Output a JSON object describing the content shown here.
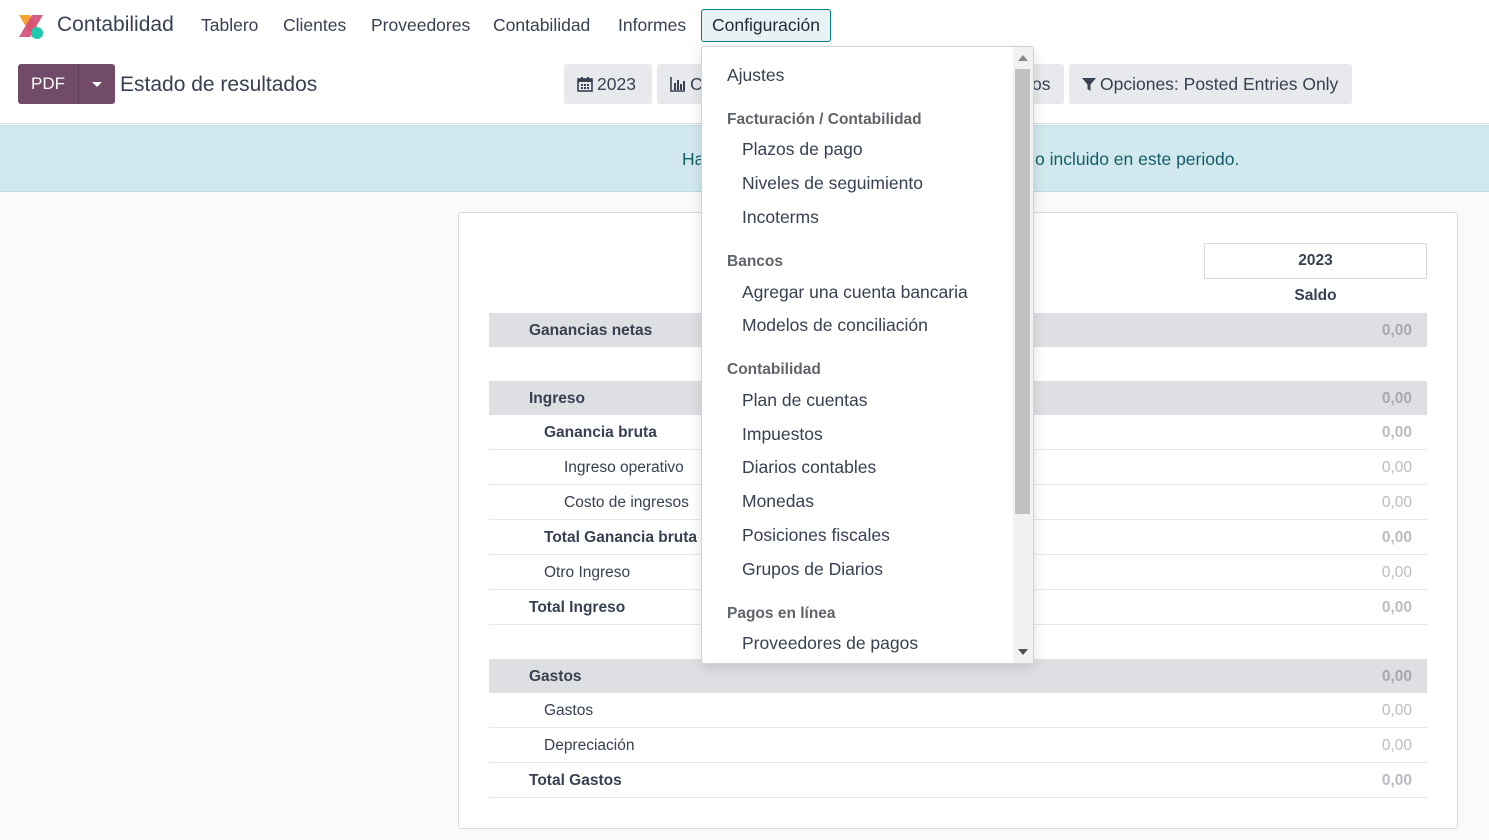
{
  "navbar": {
    "app_name": "Contabilidad",
    "menu": [
      "Tablero",
      "Clientes",
      "Proveedores",
      "Contabilidad",
      "Informes",
      "Configuración"
    ],
    "active_menu": "Configuración"
  },
  "control_panel": {
    "pdf_label": "PDF",
    "title": "Estado de resultados",
    "period_label": "2023",
    "comparison_label": "C",
    "journals_label": "os",
    "options_label": "Opciones: Posted Entries Only"
  },
  "alert": {
    "text_start": "Ha",
    "text_end": "o incluido en este periodo."
  },
  "report": {
    "column_year": "2023",
    "column_sub": "Saldo",
    "rows": [
      {
        "label": "Ganancias netas",
        "value": "0,00"
      },
      {
        "label": "Ingreso",
        "value": "0,00"
      },
      {
        "label": "Ganancia bruta",
        "value": "0,00"
      },
      {
        "label": "Ingreso operativo",
        "value": "0,00"
      },
      {
        "label": "Costo de ingresos",
        "value": "0,00"
      },
      {
        "label": "Total Ganancia bruta",
        "value": "0,00"
      },
      {
        "label": "Otro Ingreso",
        "value": "0,00"
      },
      {
        "label": "Total Ingreso",
        "value": "0,00"
      },
      {
        "label": "Gastos",
        "value": "0,00"
      },
      {
        "label": "Gastos",
        "value": "0,00"
      },
      {
        "label": "Depreciación",
        "value": "0,00"
      },
      {
        "label": "Total Gastos",
        "value": "0,00"
      }
    ]
  },
  "config_menu": {
    "ajustes": "Ajustes",
    "section_billing": "Facturación / Contabilidad",
    "billing_items": [
      "Plazos de pago",
      "Niveles de seguimiento",
      "Incoterms"
    ],
    "section_banks": "Bancos",
    "bank_items": [
      "Agregar una cuenta bancaria",
      "Modelos de conciliación"
    ],
    "section_accounting": "Contabilidad",
    "accounting_items": [
      "Plan de cuentas",
      "Impuestos",
      "Diarios contables",
      "Monedas",
      "Posiciones fiscales",
      "Grupos de Diarios"
    ],
    "section_online": "Pagos en línea",
    "online_items": [
      "Proveedores de pagos"
    ]
  },
  "colors": {
    "brand": "#714b67",
    "accent": "#017e84",
    "alert_bg": "#d1e9ee"
  },
  "icons": [
    "app-logo-icon",
    "caret-down-icon",
    "calendar-icon",
    "bar-chart-icon",
    "filter-icon"
  ]
}
